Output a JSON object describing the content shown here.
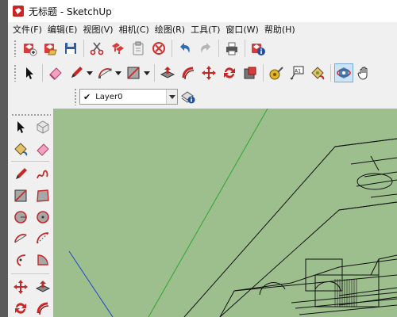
{
  "window": {
    "title": "无标题 - SketchUp"
  },
  "menu": [
    "文件(F)",
    "编辑(E)",
    "视图(V)",
    "相机(C)",
    "绘图(R)",
    "工具(T)",
    "窗口(W)",
    "帮助(H)"
  ],
  "layers": {
    "current": "Layer0",
    "check": "✔"
  },
  "toolbar_main": [
    "new-icon",
    "open-icon",
    "save-icon",
    "cut-icon",
    "copy-icon",
    "paste-icon",
    "erase-icon",
    "undo-icon",
    "redo-icon",
    "print-icon",
    "model-info-icon"
  ],
  "toolbar_draw": [
    "select-icon",
    "eraser-icon",
    "pencil-icon",
    "arc-icon",
    "rectangle-icon",
    "push-pull-icon",
    "follow-me-icon",
    "move-icon",
    "rotate-icon",
    "scale-icon",
    "tape-measure-icon",
    "text-icon",
    "paint-bucket-icon",
    "orbit-icon",
    "pan-icon"
  ],
  "colors": {
    "viewport": "#9dbf8e",
    "green_axis": "#2fa52f",
    "blue_axis": "#2040d0",
    "model_lines": "#111111"
  }
}
